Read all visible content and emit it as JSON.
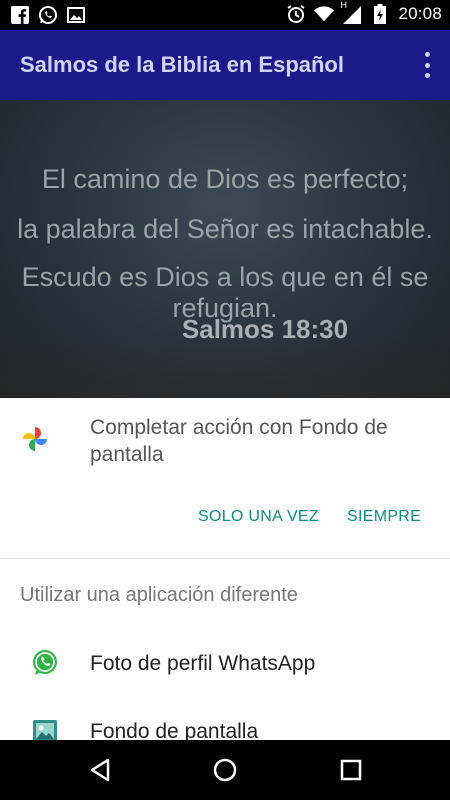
{
  "status_bar": {
    "time": "20:08",
    "left_icons": [
      "facebook-icon",
      "whatsapp-icon",
      "image-icon"
    ],
    "right_icons": [
      "alarm-icon",
      "wifi-icon",
      "signal-h-icon",
      "battery-icon"
    ],
    "signal_type": "H"
  },
  "app_bar": {
    "title": "Salmos de la Biblia en Español",
    "background": "#1a1a8a"
  },
  "image": {
    "line1": "El camino de Dios es perfecto;",
    "line2": "la palabra del Señor es intachable.",
    "line3": "Escudo es Dios a los que en él se refugian.",
    "reference": "Salmos 18:30"
  },
  "sheet": {
    "complete_text": "Completar acción con Fondo de pantalla",
    "complete_icon": "google-photos-pinwheel-icon",
    "button_once": "SOLO UNA VEZ",
    "button_always": "SIEMPRE",
    "accent": "#0b8e82",
    "section_title": "Utilizar una aplicación diferente",
    "apps": [
      {
        "label": "Foto de perfil WhatsApp",
        "icon": "whatsapp-icon"
      },
      {
        "label": "Fondo de pantalla",
        "icon": "gallery-icon"
      }
    ]
  },
  "nav_bar": {
    "buttons": [
      "back-icon",
      "home-icon",
      "recents-icon"
    ]
  }
}
